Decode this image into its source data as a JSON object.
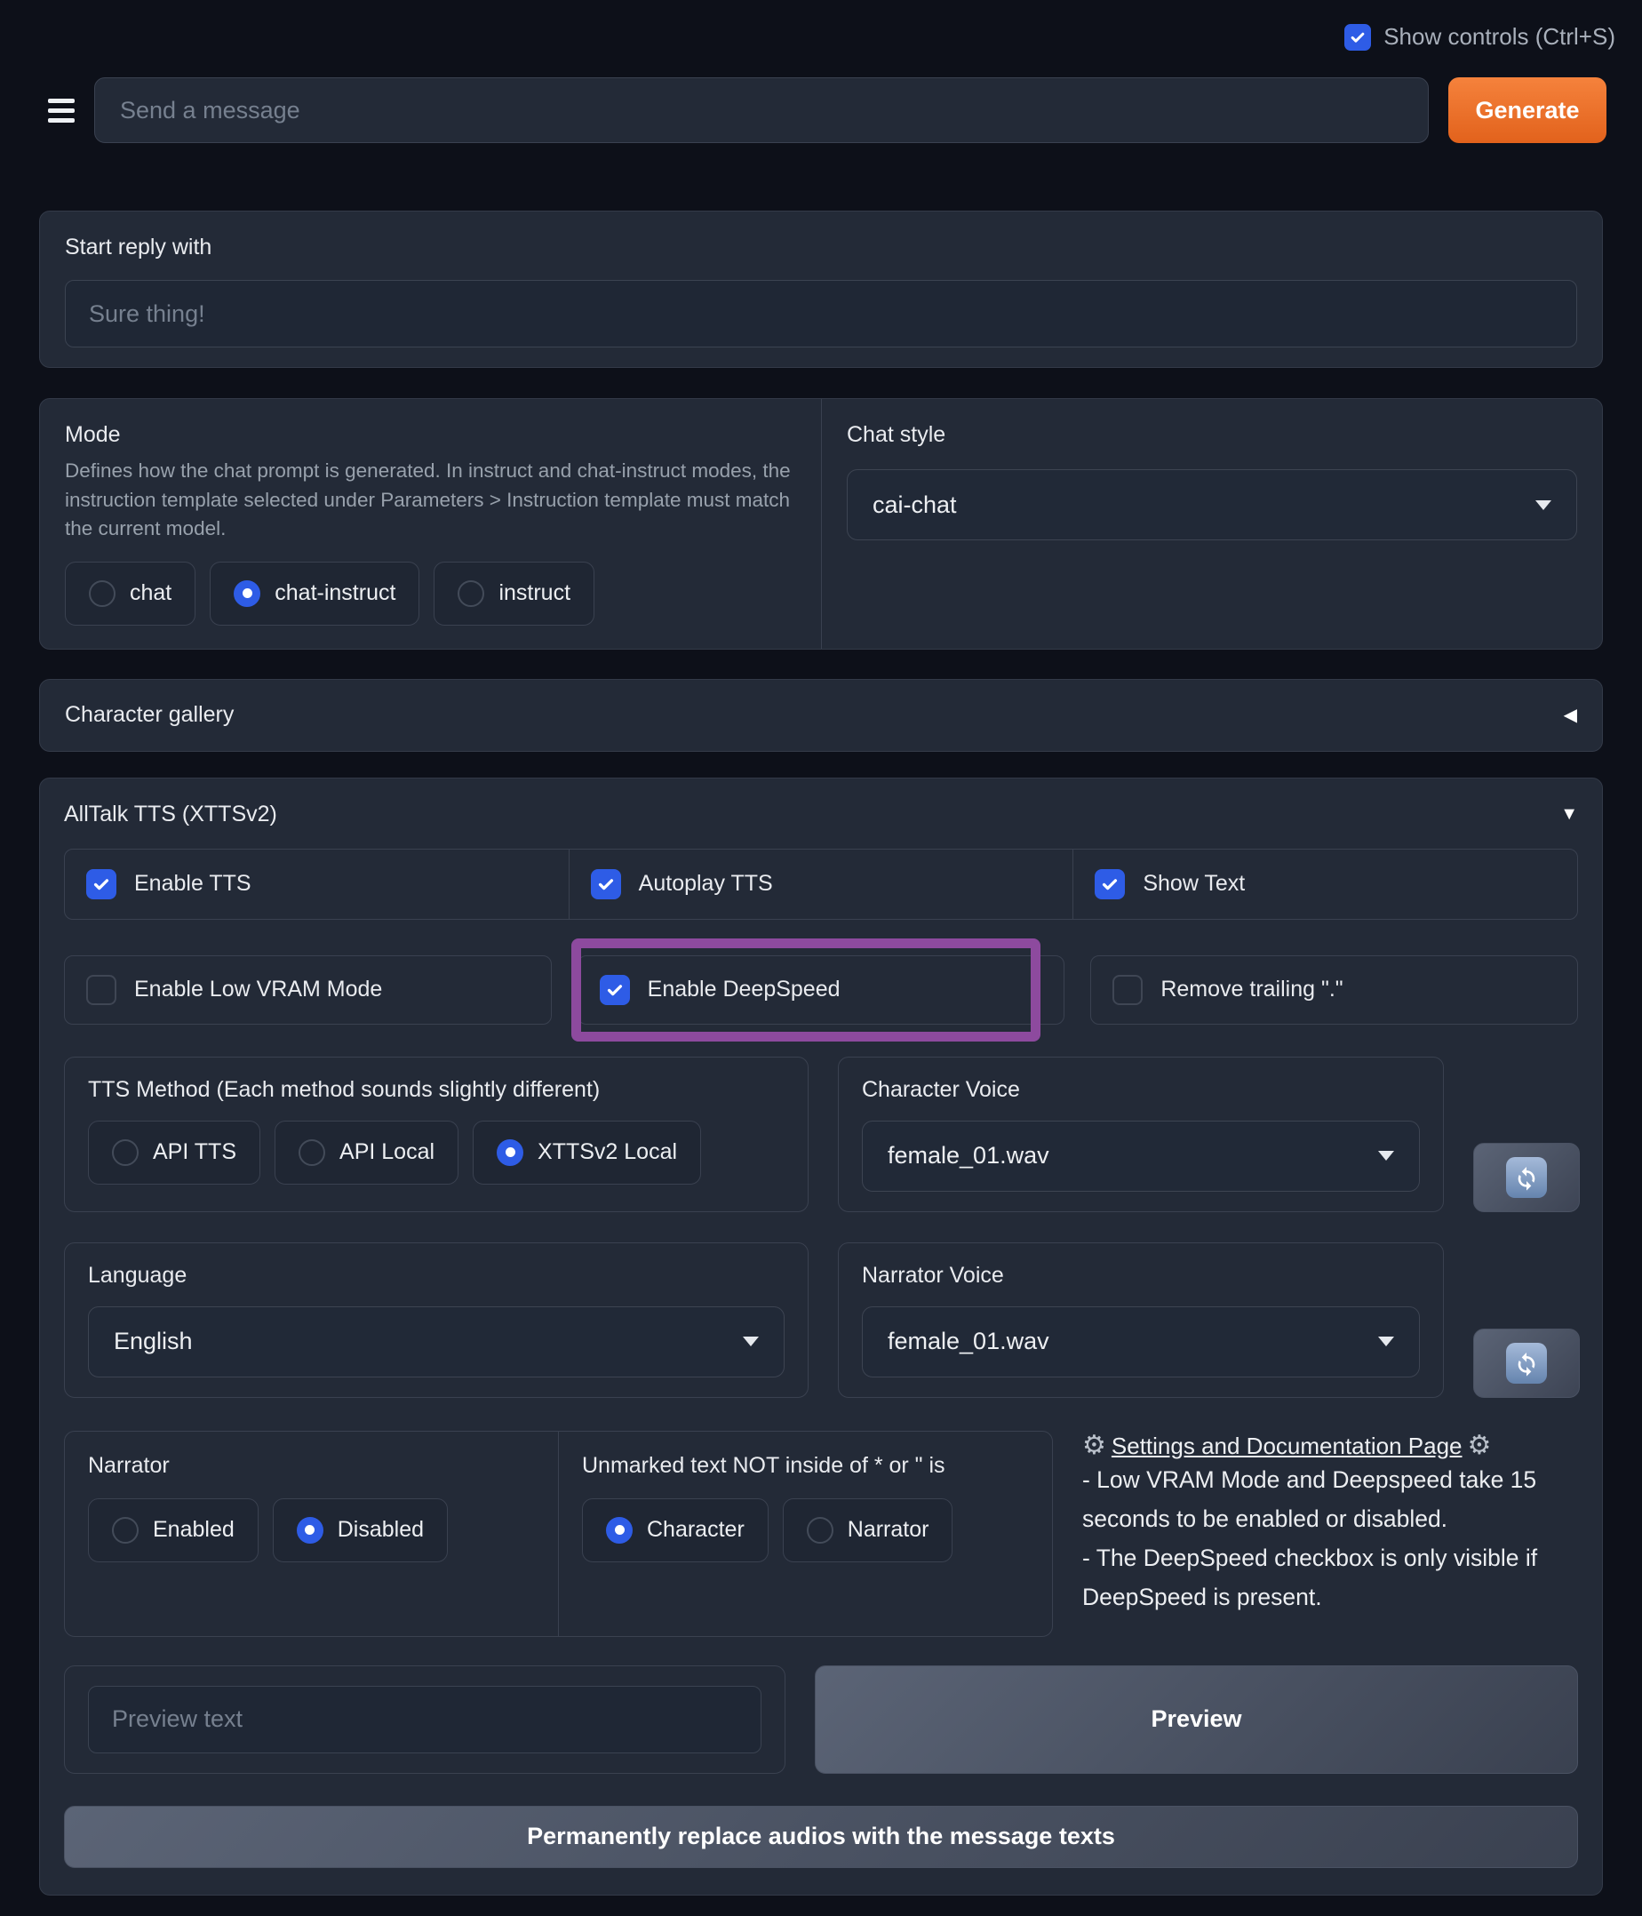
{
  "header": {
    "show_controls_label": "Show controls (Ctrl+S)",
    "show_controls_checked": true,
    "message_placeholder": "Send a message",
    "generate_label": "Generate"
  },
  "start_reply": {
    "label": "Start reply with",
    "placeholder": "Sure thing!"
  },
  "mode": {
    "label": "Mode",
    "description": "Defines how the chat prompt is generated. In instruct and chat-instruct modes, the instruction template selected under Parameters > Instruction template must match the current model.",
    "options": [
      "chat",
      "chat-instruct",
      "instruct"
    ],
    "selected": "chat-instruct"
  },
  "chat_style": {
    "label": "Chat style",
    "value": "cai-chat"
  },
  "character_gallery": {
    "label": "Character gallery"
  },
  "alltalk": {
    "title": "AllTalk TTS (XTTSv2)",
    "checkbox_row1": [
      {
        "label": "Enable TTS",
        "checked": true
      },
      {
        "label": "Autoplay TTS",
        "checked": true
      },
      {
        "label": "Show Text",
        "checked": true
      }
    ],
    "checkbox_row2": [
      {
        "label": "Enable Low VRAM Mode",
        "checked": false
      },
      {
        "label": "Enable DeepSpeed",
        "checked": true,
        "highlighted": true
      },
      {
        "label": "Remove trailing \".\"",
        "checked": false
      }
    ],
    "tts_method": {
      "label": "TTS Method (Each method sounds slightly different)",
      "options": [
        "API TTS",
        "API Local",
        "XTTSv2 Local"
      ],
      "selected": "XTTSv2 Local"
    },
    "character_voice": {
      "label": "Character Voice",
      "value": "female_01.wav"
    },
    "language": {
      "label": "Language",
      "value": "English"
    },
    "narrator_voice": {
      "label": "Narrator Voice",
      "value": "female_01.wav"
    },
    "narrator": {
      "label": "Narrator",
      "options": [
        "Enabled",
        "Disabled"
      ],
      "selected": "Disabled"
    },
    "unmarked": {
      "label": "Unmarked text NOT inside of * or \" is",
      "options": [
        "Character",
        "Narrator"
      ],
      "selected": "Character"
    },
    "docs": {
      "link_label": "Settings and Documentation Page",
      "note1": "- Low VRAM Mode and Deepspeed take 15 seconds to be enabled or disabled.",
      "note2": "- The DeepSpeed checkbox is only visible if DeepSpeed is present."
    },
    "preview": {
      "placeholder": "Preview text",
      "button_label": "Preview"
    },
    "replace_button_label": "Permanently replace audios with the message texts"
  },
  "icons": {
    "menu": "hamburger",
    "collapse_left": "◀",
    "collapse_down": "▼",
    "gear": "⚙",
    "refresh": "sync-arrows",
    "dropdown_caret": "▾"
  },
  "colors": {
    "page_bg": "#0d1019",
    "panel_bg": "#232a37",
    "accent_blue": "#2e5ce6",
    "accent_orange": "#ec6f28",
    "highlight_purple": "#8d4a9e"
  }
}
